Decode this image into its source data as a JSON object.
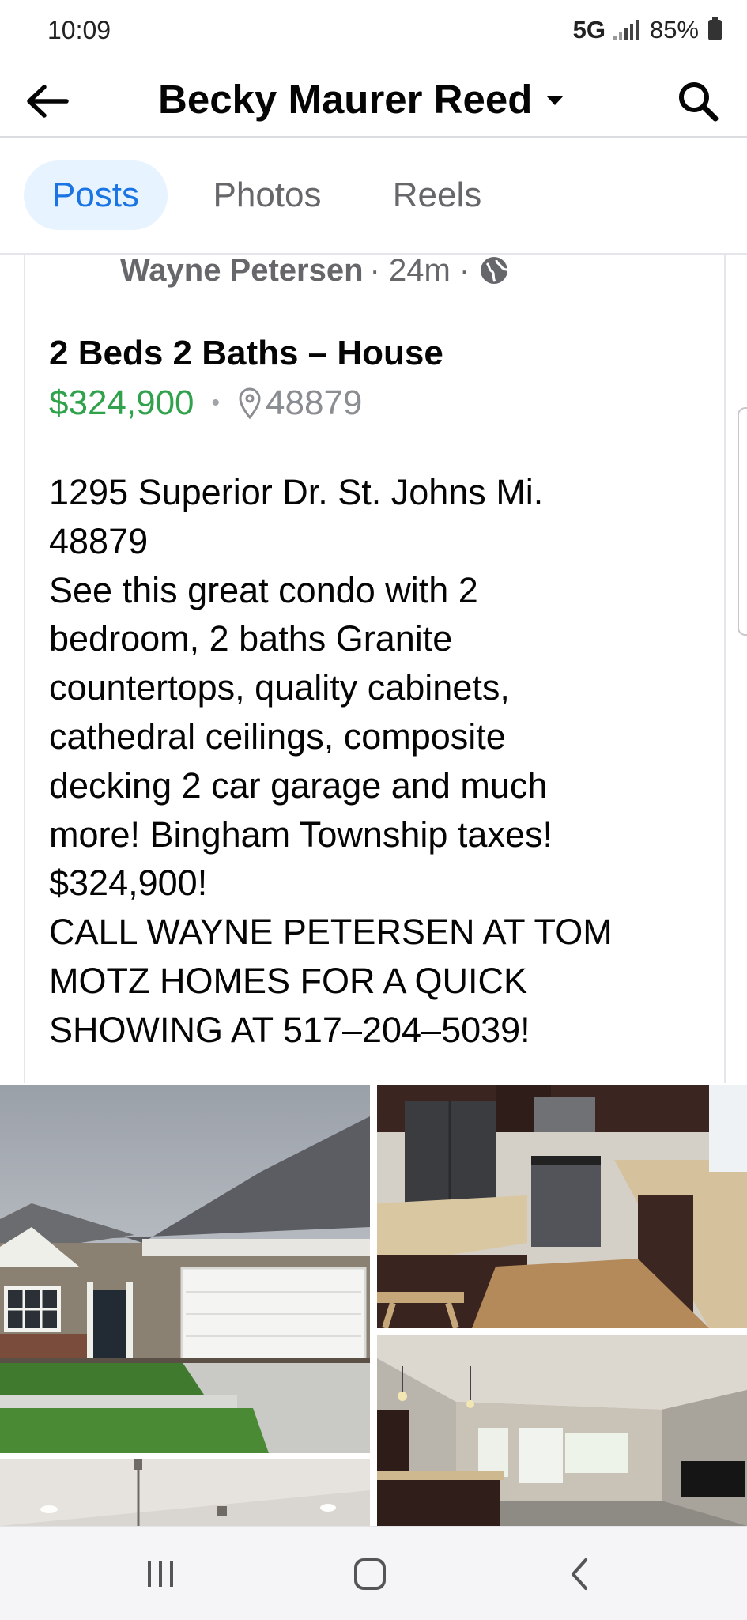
{
  "status_bar": {
    "time": "10:09",
    "network": "5G",
    "battery": "85%"
  },
  "header": {
    "title": "Becky Maurer Reed",
    "back_icon": "arrow-left-icon",
    "search_icon": "search-icon"
  },
  "tabs": [
    {
      "label": "Posts",
      "active": true
    },
    {
      "label": "Photos",
      "active": false
    },
    {
      "label": "Reels",
      "active": false
    }
  ],
  "post": {
    "author": "Wayne Petersen",
    "time": "· 24m ·",
    "listing_title": "2 Beds 2 Baths – House",
    "price": "$324,900",
    "separator": "•",
    "zip": "48879",
    "description_lines": [
      "1295 Superior Dr. St. Johns Mi.",
      "48879",
      "See this great condo with 2",
      "bedroom, 2 baths Granite",
      "countertops, quality cabinets,",
      "cathedral ceilings, composite",
      "decking 2 car garage and much",
      "more! Bingham Township taxes!",
      "$324,900!",
      "CALL WAYNE PETERSEN AT TOM",
      "MOTZ HOMES FOR A QUICK",
      "SHOWING AT 517–204–5039!"
    ]
  },
  "photos": [
    {
      "name": "house-exterior-photo"
    },
    {
      "name": "kitchen-photo"
    },
    {
      "name": "living-room-photo"
    },
    {
      "name": "ceiling-photo"
    }
  ],
  "colors": {
    "accent_blue": "#1b74e4",
    "tab_active_bg": "#e7f3ff",
    "price_green": "#31a24c",
    "secondary_text": "#65676b"
  }
}
